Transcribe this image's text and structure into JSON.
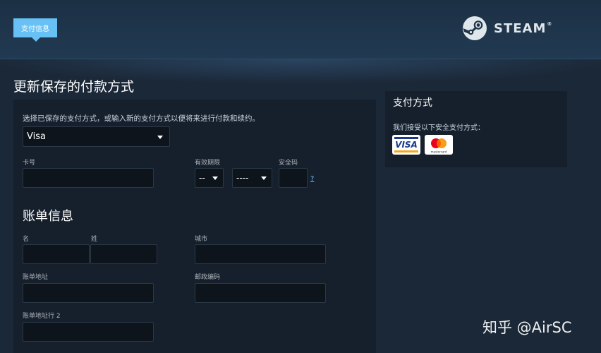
{
  "header": {
    "step_badge": "支付信息",
    "logo_text": "STEAM",
    "logo_mark": "®"
  },
  "page_title": "更新保存的付款方式",
  "form": {
    "intro": "选择已保存的支付方式，或输入新的支付方式以便将来进行付款和续约。",
    "payment_method_selected": "Visa",
    "card_number_label": "卡号",
    "expiration_label": "有效期限",
    "expiration_month_value": "--",
    "expiration_year_value": "----",
    "security_code_label": "安全码",
    "security_help": "?",
    "billing_section_title": "账单信息",
    "first_name_label": "名",
    "last_name_label": "姓",
    "city_label": "城市",
    "billing_address_label": "账单地址",
    "postal_code_label": "邮政编码",
    "billing_address2_label": "账单地址行 2"
  },
  "sidebar": {
    "title": "支付方式",
    "accepted_text": "我们接受以下安全支付方式：",
    "cards": [
      {
        "name": "visa-card-icon",
        "text": "VISA"
      },
      {
        "name": "mastercard-card-icon",
        "text": "mastercard"
      }
    ]
  },
  "watermark": "知乎 @AirSC",
  "colors": {
    "accent": "#67c1f5",
    "background": "#1b2838",
    "panel": "#16202d",
    "input": "#0e141b"
  }
}
